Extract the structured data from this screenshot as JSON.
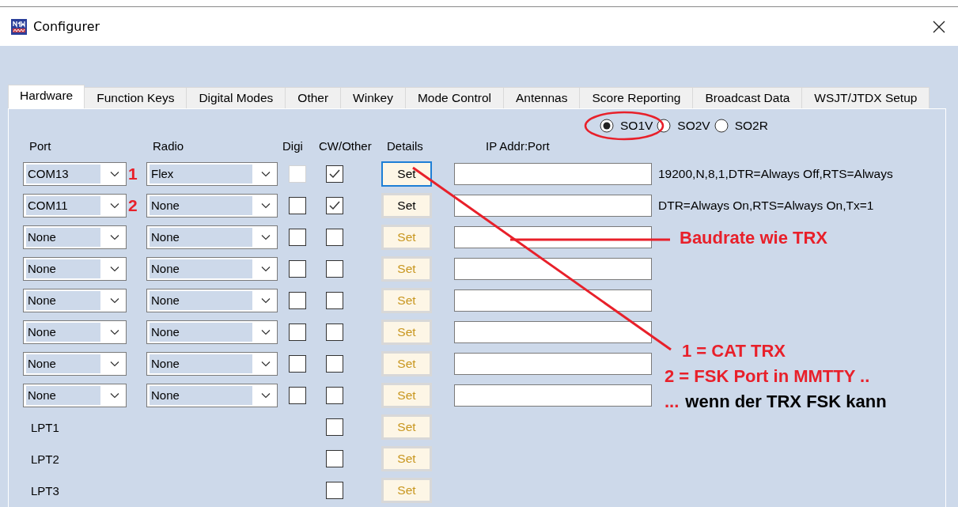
{
  "window": {
    "title": "Configurer"
  },
  "tabs": [
    {
      "label": "Hardware",
      "selected": true
    },
    {
      "label": "Function Keys",
      "selected": false
    },
    {
      "label": "Digital Modes",
      "selected": false
    },
    {
      "label": "Other",
      "selected": false
    },
    {
      "label": "Winkey",
      "selected": false
    },
    {
      "label": "Mode Control",
      "selected": false
    },
    {
      "label": "Antennas",
      "selected": false
    },
    {
      "label": "Score Reporting",
      "selected": false
    },
    {
      "label": "Broadcast Data",
      "selected": false
    },
    {
      "label": "WSJT/JTDX Setup",
      "selected": false
    }
  ],
  "operating_mode": [
    {
      "label": "SO1V",
      "selected": true
    },
    {
      "label": "SO2V",
      "selected": false
    },
    {
      "label": "SO2R",
      "selected": false
    }
  ],
  "columns": [
    "Port",
    "Radio",
    "Digi",
    "CW/Other",
    "Details",
    "IP Addr:Port"
  ],
  "rows": [
    {
      "kind": "com",
      "port": "COM13",
      "marker": "1",
      "radio": "Flex",
      "digi": {
        "checked": false,
        "disabled": true
      },
      "cw": {
        "checked": true
      },
      "set": {
        "label": "Set",
        "disabled": false,
        "focused": true
      },
      "info": "19200,N,8,1,DTR=Always Off,RTS=Always"
    },
    {
      "kind": "com",
      "port": "COM11",
      "marker": "2",
      "radio": "None",
      "digi": {
        "checked": false,
        "disabled": false
      },
      "cw": {
        "checked": true
      },
      "set": {
        "label": "Set",
        "disabled": false,
        "focused": false
      },
      "info": "DTR=Always On,RTS=Always On,Tx=1"
    },
    {
      "kind": "com",
      "port": "None",
      "radio": "None",
      "digi": {
        "checked": false,
        "disabled": false
      },
      "cw": {
        "checked": false
      },
      "set": {
        "label": "Set",
        "disabled": true,
        "focused": false
      }
    },
    {
      "kind": "com",
      "port": "None",
      "radio": "None",
      "digi": {
        "checked": false,
        "disabled": false
      },
      "cw": {
        "checked": false
      },
      "set": {
        "label": "Set",
        "disabled": true,
        "focused": false
      }
    },
    {
      "kind": "com",
      "port": "None",
      "radio": "None",
      "digi": {
        "checked": false,
        "disabled": false
      },
      "cw": {
        "checked": false
      },
      "set": {
        "label": "Set",
        "disabled": true,
        "focused": false
      }
    },
    {
      "kind": "com",
      "port": "None",
      "radio": "None",
      "digi": {
        "checked": false,
        "disabled": false
      },
      "cw": {
        "checked": false
      },
      "set": {
        "label": "Set",
        "disabled": true,
        "focused": false
      }
    },
    {
      "kind": "com",
      "port": "None",
      "radio": "None",
      "digi": {
        "checked": false,
        "disabled": false
      },
      "cw": {
        "checked": false
      },
      "set": {
        "label": "Set",
        "disabled": true,
        "focused": false
      }
    },
    {
      "kind": "com",
      "port": "None",
      "radio": "None",
      "digi": {
        "checked": false,
        "disabled": false
      },
      "cw": {
        "checked": false
      },
      "set": {
        "label": "Set",
        "disabled": true,
        "focused": false
      }
    },
    {
      "kind": "lpt",
      "port": "LPT1",
      "cw": {
        "checked": false
      },
      "set": {
        "label": "Set",
        "disabled": true,
        "focused": false
      }
    },
    {
      "kind": "lpt",
      "port": "LPT2",
      "cw": {
        "checked": false
      },
      "set": {
        "label": "Set",
        "disabled": true,
        "focused": false
      }
    },
    {
      "kind": "lpt",
      "port": "LPT3",
      "cw": {
        "checked": false
      },
      "set": {
        "label": "Set",
        "disabled": true,
        "focused": false
      }
    }
  ],
  "annotations": {
    "baudrate_note": "Baudrate wie TRX",
    "legend": [
      [
        {
          "text": "1 = CAT TRX",
          "color": "#e8202a"
        }
      ],
      [
        {
          "text": "2 = FSK Port in MMTTY ..",
          "color": "#e8202a"
        }
      ],
      [
        {
          "text": "...",
          "color": "#e8202a"
        },
        {
          "text": "wenn der TRX FSK kann",
          "color": "#000000"
        }
      ]
    ]
  }
}
